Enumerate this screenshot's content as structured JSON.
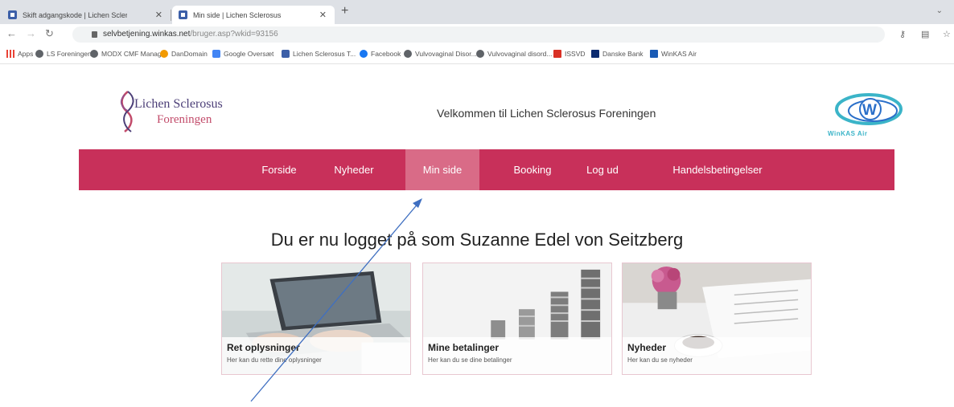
{
  "browser": {
    "tabs": [
      {
        "label": "Skift adgangskode | Lichen Scler...",
        "active": false
      },
      {
        "label": "Min side | Lichen Sclerosus",
        "active": true
      }
    ],
    "url_host": "selvbetjening.winkas.net",
    "url_path": "/bruger.asp?wkid=93156",
    "bookmarks": [
      {
        "label": "Apps",
        "icon": "apps-grid-icon",
        "color": "#e94235"
      },
      {
        "label": "LS Foreningen",
        "icon": "globe-icon",
        "color": "#5f6368"
      },
      {
        "label": "MODX CMF Manag...",
        "icon": "globe-icon",
        "color": "#5f6368"
      },
      {
        "label": "DanDomain",
        "icon": "dandomain-icon",
        "color": "#f29a00"
      },
      {
        "label": "Google Oversæt",
        "icon": "translate-icon",
        "color": "#4285f4"
      },
      {
        "label": "Lichen Sclerosus T...",
        "icon": "site-icon",
        "color": "#3c5fa8"
      },
      {
        "label": "Facebook",
        "icon": "facebook-icon",
        "color": "#1877f2"
      },
      {
        "label": "Vulvovaginal Disor...",
        "icon": "globe-icon",
        "color": "#5f6368"
      },
      {
        "label": "Vulvovaginal disord...",
        "icon": "globe-icon",
        "color": "#5f6368"
      },
      {
        "label": "ISSVD",
        "icon": "issvd-icon",
        "color": "#d93025"
      },
      {
        "label": "Danske Bank",
        "icon": "bank-icon",
        "color": "#0b2a6f"
      },
      {
        "label": "WinKAS Air",
        "icon": "winkas-icon",
        "color": "#1a5bb5"
      }
    ]
  },
  "site": {
    "logo_name": "Lichen Sclerosus",
    "logo_sub": "Foreningen",
    "welcome": "Velkommen til Lichen Sclerosus Foreningen",
    "partner_logo_text": "WinKAS Air",
    "nav": [
      {
        "label": "Forside",
        "active": false
      },
      {
        "label": "Nyheder",
        "active": false
      },
      {
        "label": "Min side",
        "active": true
      },
      {
        "label": "Booking",
        "active": false
      },
      {
        "label": "Log ud",
        "active": false
      },
      {
        "label": "Handelsbetingelser",
        "active": false
      }
    ],
    "heading": "Du er nu logget på som Suzanne Edel von Seitzberg",
    "cards": [
      {
        "title": "Ret oplysninger",
        "subtitle": "Her kan du rette dine oplysninger"
      },
      {
        "title": "Mine betalinger",
        "subtitle": "Her kan du se dine betalinger"
      },
      {
        "title": "Nyheder",
        "subtitle": "Her kan du se nyheder"
      }
    ]
  },
  "colors": {
    "brand": "#c8305a",
    "brand_active": "#d96b87",
    "arrow": "#3f6fc1"
  }
}
